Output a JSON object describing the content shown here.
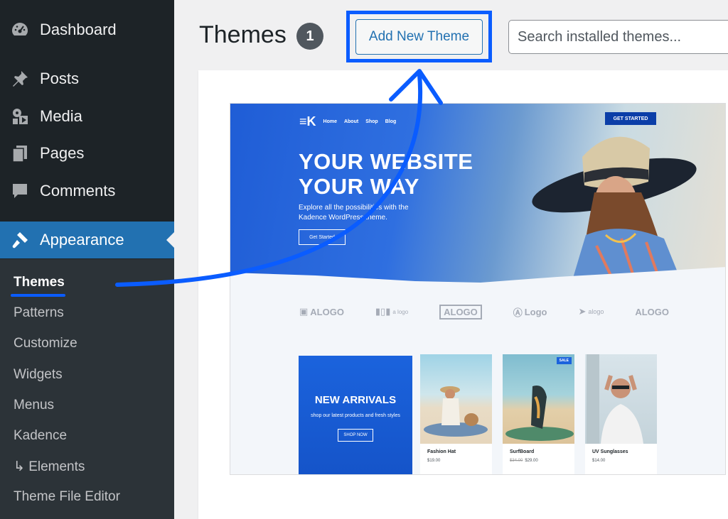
{
  "sidebar": {
    "menu": [
      {
        "label": "Dashboard",
        "icon": "dashboard-icon"
      },
      {
        "label": "Posts",
        "icon": "pin-icon"
      },
      {
        "label": "Media",
        "icon": "media-icon"
      },
      {
        "label": "Pages",
        "icon": "pages-icon"
      },
      {
        "label": "Comments",
        "icon": "comments-icon"
      },
      {
        "label": "Appearance",
        "icon": "paintbrush-icon"
      }
    ],
    "submenu": [
      {
        "label": "Themes"
      },
      {
        "label": "Patterns"
      },
      {
        "label": "Customize"
      },
      {
        "label": "Widgets"
      },
      {
        "label": "Menus"
      },
      {
        "label": "Kadence"
      },
      {
        "label": "↳ Elements"
      },
      {
        "label": "Theme File Editor"
      }
    ]
  },
  "header": {
    "title": "Themes",
    "count": "1",
    "add_button": "Add New Theme",
    "search_placeholder": "Search installed themes..."
  },
  "theme_preview": {
    "nav": [
      "Home",
      "About",
      "Shop",
      "Blog"
    ],
    "cta": "GET STARTED",
    "hero_title_1": "YOUR WEBSITE",
    "hero_title_2": "YOUR WAY",
    "hero_sub": "Explore all the possibilities with the Kadence WordPress theme.",
    "hero_button": "Get Started",
    "logos": [
      "ALOGO",
      "a logo",
      "ALOGO",
      "Logo",
      "alogo",
      "ALOGO"
    ],
    "promo": {
      "title": "NEW ARRIVALS",
      "subtitle": "shop our latest products and fresh styles",
      "button": "SHOP NOW"
    },
    "products": [
      {
        "name": "Fashion Hat",
        "price": "$19.00",
        "old_price": ""
      },
      {
        "name": "SurfBoard",
        "price": "$29.00",
        "old_price": "$34.00",
        "badge": "SALE"
      },
      {
        "name": "UV Sunglasses",
        "price": "$14.00",
        "old_price": ""
      }
    ]
  },
  "colors": {
    "sidebar_bg": "#1d2327",
    "active_bg": "#2271b1",
    "annotation_blue": "#0a5cff"
  }
}
